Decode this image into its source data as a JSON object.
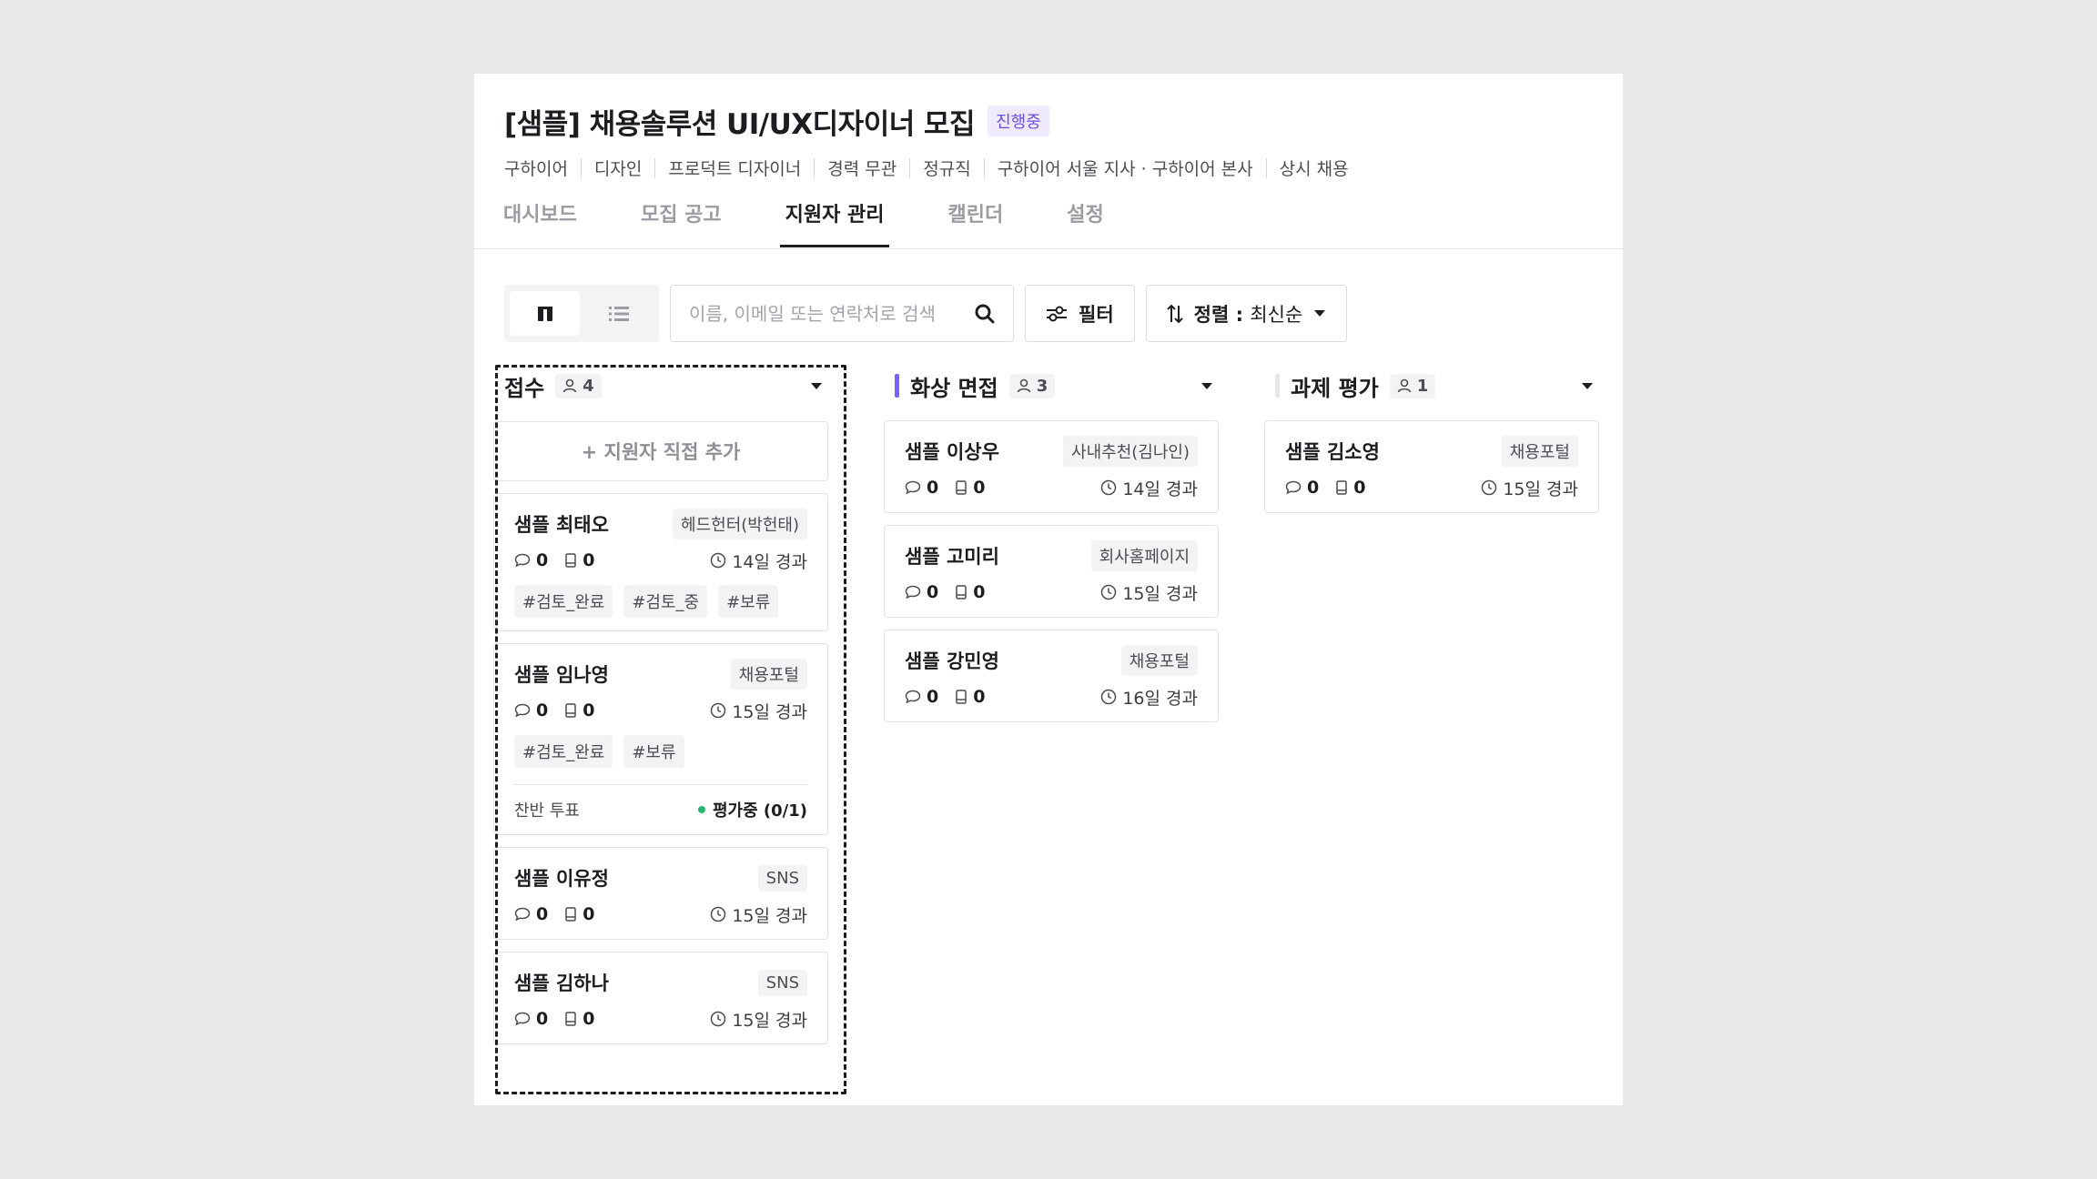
{
  "header": {
    "title": "[샘플] 채용솔루션 UI/UX디자이너 모집",
    "status": "진행중",
    "meta": [
      "구하이어",
      "디자인",
      "프로덕트 디자이너",
      "경력 무관",
      "정규직",
      "구하이어 서울 지사 · 구하이어 본사",
      "상시 채용"
    ]
  },
  "tabs": [
    "대시보드",
    "모집 공고",
    "지원자 관리",
    "캘린더",
    "설정"
  ],
  "active_tab": "지원자 관리",
  "toolbar": {
    "search_placeholder": "이름, 이메일 또는 연락처로 검색",
    "filter_label": "필터",
    "sort_label": "정렬 :",
    "sort_value": "최신순"
  },
  "columns": [
    {
      "name": "접수",
      "count": "4",
      "bar_color": "",
      "add_label": "+ 지원자 직접 추가",
      "cards": [
        {
          "name": "샘플 최태오",
          "source": "헤드헌터(박헌태)",
          "comments": "0",
          "files": "0",
          "elapsed": "14일 경과",
          "tags": [
            "#검토_완료",
            "#검토_중",
            "#보류"
          ]
        },
        {
          "name": "샘플 임나영",
          "source": "채용포털",
          "comments": "0",
          "files": "0",
          "elapsed": "15일 경과",
          "tags": [
            "#검토_완료",
            "#보류"
          ],
          "vote_label": "찬반 투표",
          "vote_status": "평가중 (0/1)"
        },
        {
          "name": "샘플 이유정",
          "source": "SNS",
          "comments": "0",
          "files": "0",
          "elapsed": "15일 경과"
        },
        {
          "name": "샘플 김하나",
          "source": "SNS",
          "comments": "0",
          "files": "0",
          "elapsed": "15일 경과"
        }
      ]
    },
    {
      "name": "화상 면접",
      "count": "3",
      "bar_color": "#7b61ff",
      "cards": [
        {
          "name": "샘플 이상우",
          "source": "사내추천(김나인)",
          "comments": "0",
          "files": "0",
          "elapsed": "14일 경과"
        },
        {
          "name": "샘플 고미리",
          "source": "회사홈페이지",
          "comments": "0",
          "files": "0",
          "elapsed": "15일 경과"
        },
        {
          "name": "샘플 강민영",
          "source": "채용포털",
          "comments": "0",
          "files": "0",
          "elapsed": "16일 경과"
        }
      ]
    },
    {
      "name": "과제 평가",
      "count": "1",
      "bar_color": "#e6e7ea",
      "cards": [
        {
          "name": "샘플 김소영",
          "source": "채용포털",
          "comments": "0",
          "files": "0",
          "elapsed": "15일 경과"
        }
      ]
    }
  ]
}
